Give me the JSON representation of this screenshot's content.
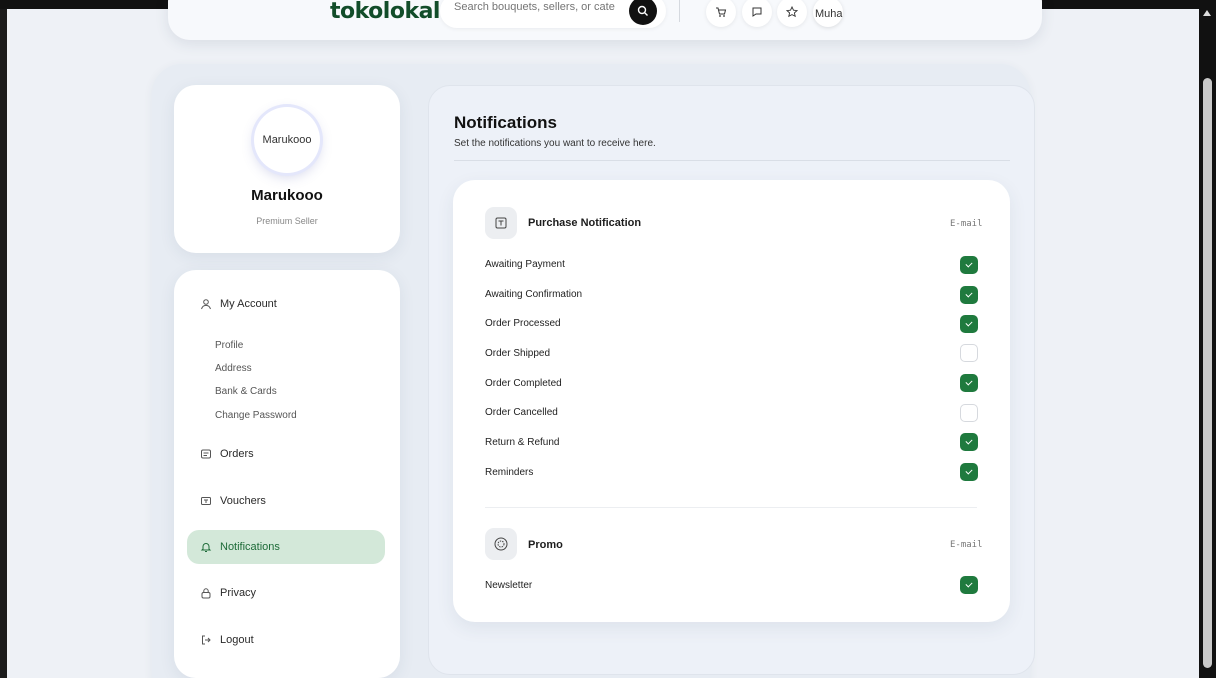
{
  "header": {
    "logo": "tokolokal",
    "search_placeholder": "Search bouquets, sellers, or cate",
    "user_short": "Muha",
    "icons": [
      "cart-icon",
      "chat-icon",
      "star-icon"
    ]
  },
  "profile": {
    "avatar_text": "Marukooo",
    "name": "Marukooo",
    "role": "Premium Seller"
  },
  "nav": {
    "my_account": "My Account",
    "sub_items": [
      "Profile",
      "Address",
      "Bank & Cards",
      "Change Password"
    ],
    "orders": "Orders",
    "vouchers": "Vouchers",
    "notifications": "Notifications",
    "privacy": "Privacy",
    "logout": "Logout"
  },
  "notifications": {
    "title": "Notifications",
    "subtitle": "Set the notifications you want to receive here.",
    "purchase": {
      "title": "Purchase Notification",
      "column": "E-mail",
      "rows": [
        {
          "label": "Awaiting Payment",
          "checked": true
        },
        {
          "label": "Awaiting Confirmation",
          "checked": true
        },
        {
          "label": "Order Processed",
          "checked": true
        },
        {
          "label": "Order Shipped",
          "checked": false
        },
        {
          "label": "Order Completed",
          "checked": true
        },
        {
          "label": "Order Cancelled",
          "checked": false
        },
        {
          "label": "Return & Refund",
          "checked": true
        },
        {
          "label": "Reminders",
          "checked": true
        }
      ]
    },
    "promo": {
      "title": "Promo",
      "column": "E-mail",
      "rows": [
        {
          "label": "Newsletter",
          "checked": true
        }
      ]
    }
  },
  "colors": {
    "accent": "#1f7a3e",
    "active_nav_bg": "#d3e8d9",
    "logo": "#124d2a"
  }
}
